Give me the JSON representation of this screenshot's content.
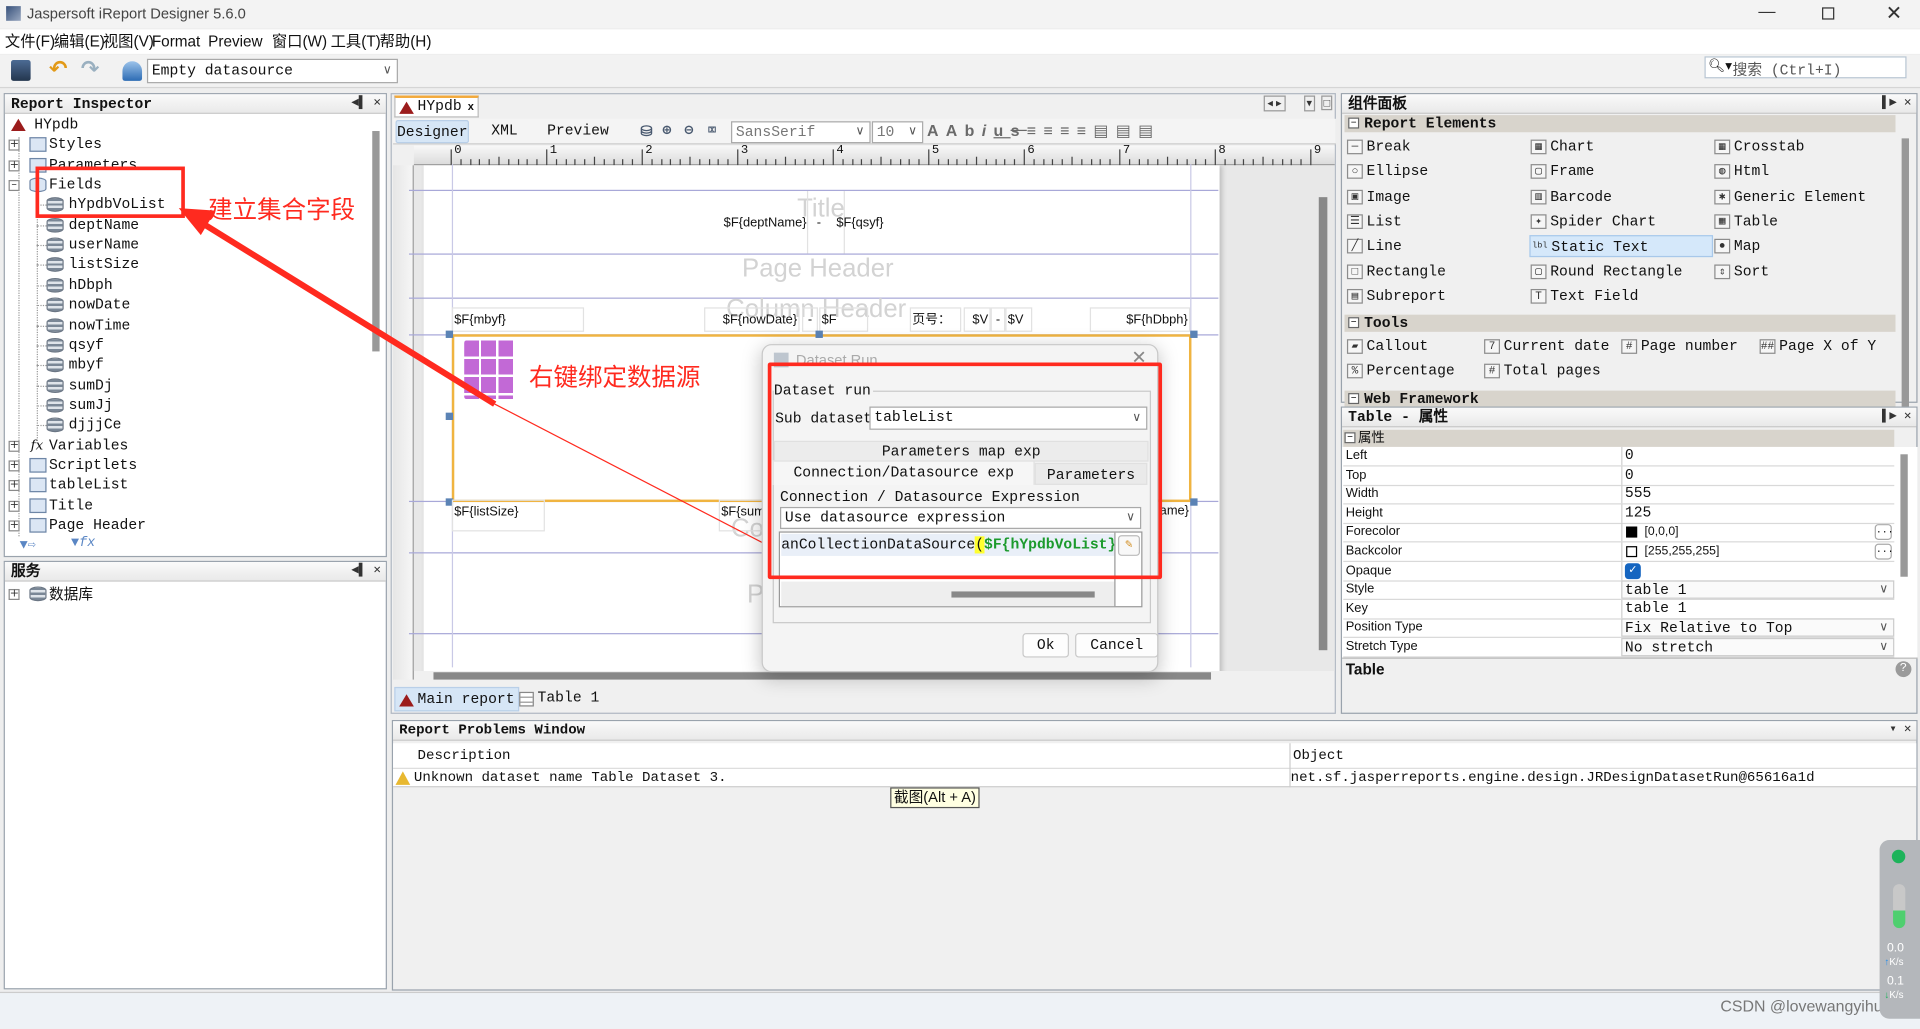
{
  "window": {
    "title": "Jaspersoft iReport Designer 5.6.0",
    "controls": [
      "minimize",
      "restore",
      "close"
    ]
  },
  "menu": [
    "文件(F)",
    "编辑(E)",
    "视图(V)",
    "Format",
    "Preview",
    "窗口(W)",
    "工具(T)",
    "帮助(H)"
  ],
  "toolbar": {
    "datasource": "Empty datasource",
    "search_placeholder": "搜索 (Ctrl+I)"
  },
  "inspector": {
    "title": "Report Inspector",
    "nodes": [
      {
        "label": "HYpdb",
        "level": 0,
        "icon": "report-icon"
      },
      {
        "label": "Styles",
        "level": 1,
        "icon": "styles-icon",
        "expander": "+"
      },
      {
        "label": "Parameters",
        "level": 1,
        "icon": "parameters-icon",
        "expander": "+"
      },
      {
        "label": "Fields",
        "level": 1,
        "icon": "fields-icon",
        "expander": "-"
      },
      {
        "label": "hYpdbVoList",
        "level": 2,
        "icon": "field-icon"
      },
      {
        "label": "deptName",
        "level": 2,
        "icon": "field-icon"
      },
      {
        "label": "userName",
        "level": 2,
        "icon": "field-icon"
      },
      {
        "label": "listSize",
        "level": 2,
        "icon": "field-icon"
      },
      {
        "label": "hDbph",
        "level": 2,
        "icon": "field-icon"
      },
      {
        "label": "nowDate",
        "level": 2,
        "icon": "field-icon"
      },
      {
        "label": "nowTime",
        "level": 2,
        "icon": "field-icon"
      },
      {
        "label": "qsyf",
        "level": 2,
        "icon": "field-icon"
      },
      {
        "label": "mbyf",
        "level": 2,
        "icon": "field-icon"
      },
      {
        "label": "sumDj",
        "level": 2,
        "icon": "field-icon"
      },
      {
        "label": "sumJj",
        "level": 2,
        "icon": "field-icon"
      },
      {
        "label": "djjjCe",
        "level": 2,
        "icon": "field-icon"
      },
      {
        "label": "Variables",
        "level": 1,
        "icon": "variables-icon",
        "expander": "+"
      },
      {
        "label": "Scriptlets",
        "level": 1,
        "icon": "scriptlets-icon",
        "expander": "+"
      },
      {
        "label": "tableList",
        "level": 1,
        "icon": "dataset-icon",
        "expander": "+"
      },
      {
        "label": "Title",
        "level": 1,
        "icon": "band-icon",
        "expander": "+"
      },
      {
        "label": "Page Header",
        "level": 1,
        "icon": "band-icon",
        "expander": "+"
      }
    ]
  },
  "services": {
    "title": "服务",
    "items": [
      {
        "label": "数据库",
        "icon": "database-icon",
        "expander": "+"
      }
    ]
  },
  "editor": {
    "tab": "HYpdb",
    "views": [
      "Designer",
      "XML",
      "Preview"
    ],
    "active_view": "Designer",
    "font": "SansSerif",
    "font_size": "10",
    "ruler": [
      "0",
      "1",
      "2",
      "3",
      "4",
      "5",
      "6",
      "7",
      "8",
      "9"
    ],
    "bands": {
      "title": "Title",
      "page_header": "Page Header",
      "column_header": "Column Header",
      "column_footer": "Co",
      "page_footer": "P"
    },
    "title_fields": [
      "$F{deptName}",
      "-",
      "$F{qsyf}"
    ],
    "header_fields": [
      "$F{mbyf}",
      "$F{nowDate}",
      "-",
      "$F",
      "页号：",
      "$V",
      "-",
      "$V",
      "$F{hDbph}"
    ],
    "footer_fields": [
      "$F{listSize}",
      "$F{sum",
      "ame}"
    ],
    "bottom_tabs": [
      "Main report",
      "Table 1"
    ],
    "active_bottom_tab": "Main report"
  },
  "annotations": {
    "fields_note": "建立集合字段",
    "datasource_note": "右键绑定数据源",
    "color": "#ff2a1f"
  },
  "dialog": {
    "title": "Dataset Run",
    "group": "Dataset run",
    "sub_dataset_label": "Sub dataset",
    "sub_dataset": "tableList",
    "tabs_row1": [
      "Parameters map exp"
    ],
    "tabs_row2": [
      "Connection/Datasource exp",
      "Parameters"
    ],
    "active_tab": "Connection/Datasource exp",
    "section_label": "Connection / Datasource Expression",
    "mode": "Use datasource expression",
    "expr_prefix": "anCollectionDataSource",
    "expr_open": "(",
    "expr_field": "$F{hYpdbVoList}",
    "expr_close": ")",
    "ok": "Ok",
    "cancel": "Cancel"
  },
  "palette": {
    "title": "组件面板",
    "sections": [
      {
        "title": "Report Elements",
        "items": [
          "Break",
          "Chart",
          "Crosstab",
          "Ellipse",
          "Frame",
          "Html",
          "Image",
          "Barcode",
          "Generic Element",
          "List",
          "Spider Chart",
          "Table",
          "Line",
          "Static Text",
          "Map",
          "Rectangle",
          "Round Rectangle",
          "Sort",
          "Subreport",
          "Text Field"
        ],
        "selected": "Static Text"
      },
      {
        "title": "Tools",
        "items": [
          "Callout",
          "Current date",
          "Page number",
          "Page X of Y",
          "Percentage",
          "Total pages"
        ]
      },
      {
        "title": "Web Framework",
        "items": []
      }
    ]
  },
  "properties": {
    "title": "Table - 属性",
    "section": "属性",
    "rows": [
      {
        "name": "Left",
        "value": "0"
      },
      {
        "name": "Top",
        "value": "0"
      },
      {
        "name": "Width",
        "value": "555"
      },
      {
        "name": "Height",
        "value": "125"
      },
      {
        "name": "Forecolor",
        "value": "[0,0,0]",
        "swatch": "#000000",
        "button": "..."
      },
      {
        "name": "Backcolor",
        "value": "[255,255,255]",
        "swatch": "#ffffff",
        "button": "..."
      },
      {
        "name": "Opaque",
        "checked": true
      },
      {
        "name": "Style",
        "value": "table 1",
        "dropdown": true
      },
      {
        "name": "Key",
        "value": "table 1"
      },
      {
        "name": "Position Type",
        "value": "Fix Relative to Top",
        "dropdown": true
      },
      {
        "name": "Stretch Type",
        "value": "No stretch",
        "dropdown": true
      }
    ],
    "description_title": "Table"
  },
  "problems": {
    "title": "Report Problems Window",
    "columns": [
      "Description",
      "Object"
    ],
    "rows": [
      {
        "description": "Unknown dataset name Table Dataset 3.",
        "object": "net.sf.jasperreports.engine.design.JRDesignDatasetRun@65616a1d",
        "severity": "warning"
      }
    ]
  },
  "tooltip": "截图(Alt + A)",
  "watermark": "CSDN @lovewangyihui",
  "net_widget": {
    "up": "0.0",
    "down": "0.1",
    "unit": "K/s",
    "status_color": "#1db35a"
  }
}
